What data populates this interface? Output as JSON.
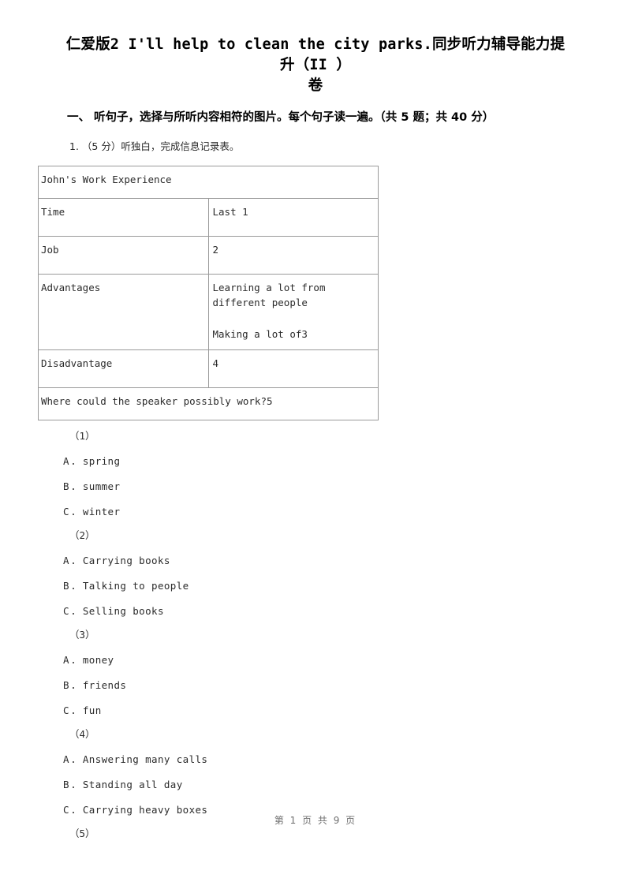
{
  "document": {
    "title_line1": "仁爱版2 I'll help to clean the city parks.同步听力辅导能力提升（II ）",
    "title_line2": "卷",
    "section_heading": "一、 听句子，选择与所听内容相符的图片。每个句子读一遍。（共 5 题；共 40 分）",
    "question_stem": "1.  （5 分）听独白，完成信息记录表。",
    "footer": "第 1 页 共 9 页"
  },
  "info_table": {
    "header": "John's Work Experience",
    "rows": [
      {
        "label": "Time",
        "value": "Last 1"
      },
      {
        "label": "Job",
        "value": "2"
      }
    ],
    "advantages": {
      "label": "Advantages",
      "line1": "Learning a lot from different people",
      "line2": "Making a lot of3"
    },
    "disadvantage": {
      "label": "Disadvantage",
      "value": "4"
    },
    "span_row": "Where could the speaker possibly work?5"
  },
  "sub_questions": [
    {
      "number": "（1）",
      "options": [
        {
          "letter": "A",
          "sep": "．",
          "text": "spring"
        },
        {
          "letter": "B",
          "sep": "．",
          "text": "summer"
        },
        {
          "letter": "C",
          "sep": "．",
          "text": "winter"
        }
      ]
    },
    {
      "number": "（2）",
      "options": [
        {
          "letter": "A",
          "sep": "．",
          "text": "Carrying books"
        },
        {
          "letter": "B",
          "sep": "．",
          "text": "Talking to people"
        },
        {
          "letter": "C",
          "sep": "．",
          "text": "Selling books"
        }
      ]
    },
    {
      "number": "（3）",
      "options": [
        {
          "letter": "A",
          "sep": "．",
          "text": "money"
        },
        {
          "letter": "B",
          "sep": "．",
          "text": "friends"
        },
        {
          "letter": "C",
          "sep": "．",
          "text": "fun"
        }
      ]
    },
    {
      "number": "（4）",
      "options": [
        {
          "letter": "A",
          "sep": "．",
          "text": "Answering many calls"
        },
        {
          "letter": "B",
          "sep": "．",
          "text": "Standing all day"
        },
        {
          "letter": "C",
          "sep": "．",
          "text": "Carrying heavy boxes"
        }
      ]
    },
    {
      "number": "（5）",
      "options": []
    }
  ],
  "colors": {
    "page_background": "#ffffff",
    "text": "#2b2b2b",
    "heading_text": "#000000",
    "table_border": "#9a9a9a",
    "footer_text": "#6f6f6f"
  }
}
